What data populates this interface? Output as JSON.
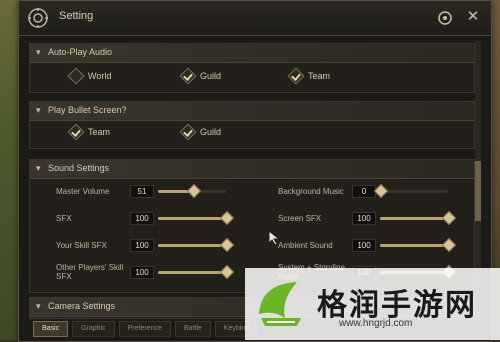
{
  "window": {
    "title": "Setting"
  },
  "sections": {
    "autoplay": {
      "title": "Auto-Play Audio",
      "options": [
        {
          "label": "World",
          "checked": false
        },
        {
          "label": "Guild",
          "checked": true
        },
        {
          "label": "Team",
          "checked": true
        }
      ]
    },
    "bullet": {
      "title": "Play Bullet Screen?",
      "options": [
        {
          "label": "Team",
          "checked": true
        },
        {
          "label": "Guild",
          "checked": true
        }
      ]
    },
    "sound": {
      "title": "Sound Settings",
      "rows_left": [
        {
          "label": "Master Volume",
          "value": "51",
          "level": 0.51
        },
        {
          "label": "SFX",
          "value": "100",
          "level": 1.0
        },
        {
          "label": "Your Skill SFX",
          "value": "100",
          "level": 1.0
        },
        {
          "label": "Other Players' Skill SFX",
          "value": "100",
          "level": 1.0
        }
      ],
      "rows_right": [
        {
          "label": "Background Music",
          "value": "0",
          "level": 0.0
        },
        {
          "label": "Screen SFX",
          "value": "100",
          "level": 1.0
        },
        {
          "label": "Ambient Sound",
          "value": "100",
          "level": 1.0
        },
        {
          "label": "System + Storyline Audio",
          "value": "100",
          "level": 1.0
        }
      ]
    },
    "camera": {
      "title": "Camera Settings"
    }
  },
  "tabs": [
    "Basic",
    "Graphic",
    "Preference",
    "Battle",
    "Keybind"
  ],
  "watermark": {
    "text": "格润手游网",
    "url": "www.hngrjd.com"
  },
  "colors": {
    "accent": "#b9a473",
    "panel": "#1c1a17",
    "text": "#d8ccb0"
  }
}
